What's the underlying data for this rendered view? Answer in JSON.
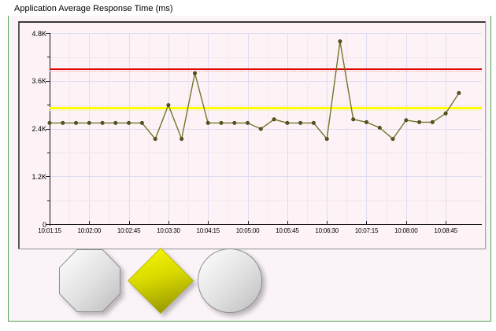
{
  "title": "Application Average Response Time (ms)",
  "chart_data": {
    "type": "line",
    "title": "Application Average Response Time (ms)",
    "ylabel": "",
    "xlabel": "",
    "ylim": [
      0,
      4800
    ],
    "grid": true,
    "legend_position": "none",
    "line_color": "#73732d",
    "marker_color": "#55551f",
    "x": [
      "10:01:15",
      "10:01:30",
      "10:01:45",
      "10:02:00",
      "10:02:15",
      "10:02:30",
      "10:02:45",
      "10:03:00",
      "10:03:15",
      "10:03:30",
      "10:03:45",
      "10:04:00",
      "10:04:15",
      "10:04:30",
      "10:04:45",
      "10:05:00",
      "10:05:15",
      "10:05:30",
      "10:05:45",
      "10:06:00",
      "10:06:15",
      "10:06:30",
      "10:06:45",
      "10:07:00",
      "10:07:15",
      "10:07:30",
      "10:07:45",
      "10:08:00",
      "10:08:15",
      "10:08:30",
      "10:08:45",
      "10:09:00"
    ],
    "values": [
      2550,
      2550,
      2550,
      2550,
      2550,
      2550,
      2550,
      2550,
      2150,
      3000,
      2150,
      3800,
      2550,
      2550,
      2550,
      2550,
      2400,
      2640,
      2550,
      2550,
      2550,
      2150,
      4600,
      2640,
      2570,
      2430,
      2150,
      2620,
      2570,
      2570,
      2790,
      3300
    ],
    "yaxis_ticks": [
      {
        "value": 0,
        "label": "0"
      },
      {
        "value": 1200,
        "label": "1.2K"
      },
      {
        "value": 2400,
        "label": "2.4K"
      },
      {
        "value": 3600,
        "label": "3.6K"
      },
      {
        "value": 4800,
        "label": "4.8K"
      }
    ],
    "yaxis_minor_ticks": [
      600,
      1800,
      3000,
      4200
    ],
    "xaxis_tick_labels": [
      "10:01:15",
      "10:02:00",
      "10:02:45",
      "10:03:30",
      "10:04:15",
      "10:05:00",
      "10:05:45",
      "10:06:30",
      "10:07:15",
      "10:08:00",
      "10:08:45"
    ],
    "thresholds": [
      {
        "name": "critical-threshold",
        "value": 3900,
        "color": "#e00000",
        "dot_color": "#f2a6a6",
        "thickness": 2
      },
      {
        "name": "warning-threshold",
        "value": 2920,
        "color": "#ffff00",
        "dot_color": "#ededa0",
        "thickness": 3
      }
    ]
  },
  "status_icons": [
    {
      "name": "octagon-status-icon",
      "shape": "octagon",
      "gradient_from": "#ffffff",
      "gradient_mid": "#e0e0e0",
      "gradient_to": "#bdbdbd",
      "border": "#8f8f8f"
    },
    {
      "name": "diamond-status-icon",
      "shape": "diamond",
      "gradient_from": "#f6f600",
      "gradient_mid": "#d8d800",
      "gradient_to": "#939300",
      "border": "#a8a800"
    },
    {
      "name": "circle-status-icon",
      "shape": "circle",
      "gradient_from": "#ffffff",
      "gradient_mid": "#e0e0e0",
      "gradient_to": "#bdbdbd",
      "border": "#8f8f8f"
    }
  ],
  "colors": {
    "frame_green": "#52a352",
    "panel_bg": "#fdf3f6",
    "box_bg": "#faf4f9",
    "grid_major": "#dddcf0",
    "grid_minor": "#e7d6df",
    "axis": "#111111"
  }
}
